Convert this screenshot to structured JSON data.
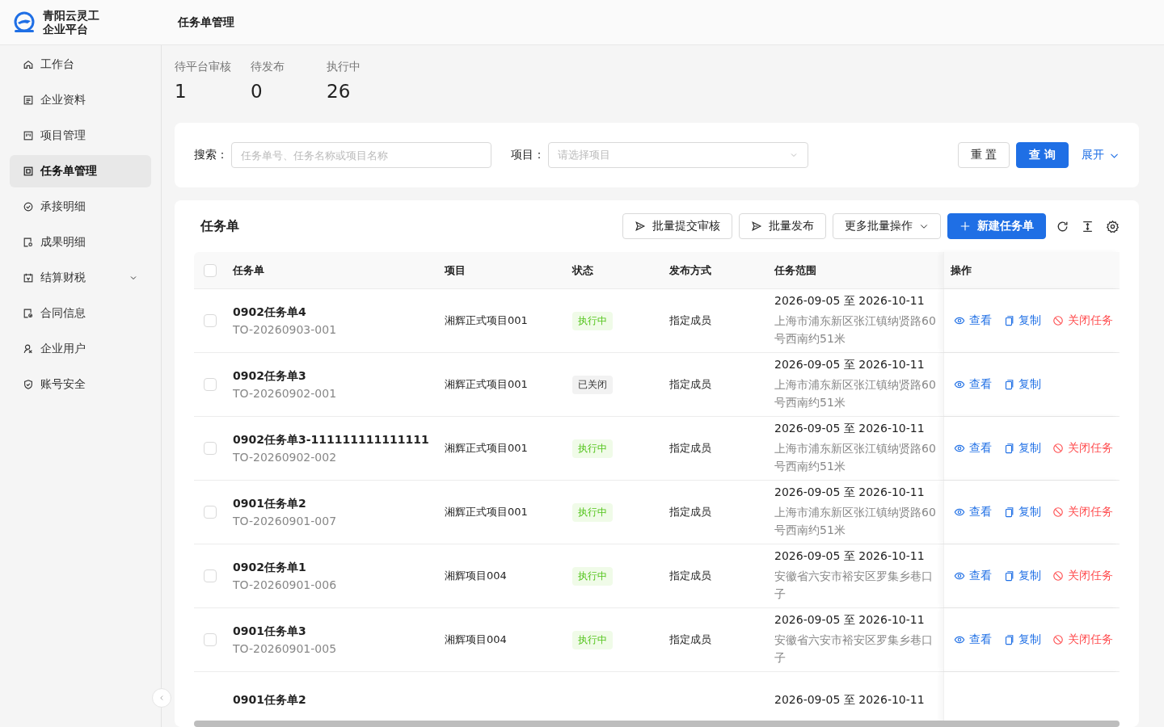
{
  "brand": {
    "line1": "青阳云灵工",
    "line2": "企业平台"
  },
  "header": {
    "title": "任务单管理"
  },
  "sidebar": {
    "items": [
      {
        "label": "工作台",
        "kind": "link",
        "selected": false
      },
      {
        "label": "企业资料",
        "kind": "link",
        "selected": false
      },
      {
        "label": "项目管理",
        "kind": "link",
        "selected": false
      },
      {
        "label": "任务单管理",
        "kind": "link",
        "selected": true
      },
      {
        "label": "承接明细",
        "kind": "link",
        "selected": false
      },
      {
        "label": "成果明细",
        "kind": "link",
        "selected": false
      },
      {
        "label": "结算财税",
        "kind": "group",
        "selected": false,
        "expanded": false
      },
      {
        "label": "合同信息",
        "kind": "link",
        "selected": false
      },
      {
        "label": "企业用户",
        "kind": "link",
        "selected": false
      },
      {
        "label": "账号安全",
        "kind": "link",
        "selected": false
      }
    ]
  },
  "stats": [
    {
      "label": "待平台审核",
      "value": "1"
    },
    {
      "label": "待发布",
      "value": "0"
    },
    {
      "label": "执行中",
      "value": "26"
    }
  ],
  "filters": {
    "search_label": "搜索：",
    "search_placeholder": "任务单号、任务名称或项目名称",
    "project_label": "项目：",
    "project_placeholder": "请选择项目",
    "reset": "重 置",
    "query": "查 询",
    "expand": "展开"
  },
  "table": {
    "title": "任务单",
    "toolbar": [
      {
        "label": "批量提交审核",
        "kind": "send"
      },
      {
        "label": "批量发布",
        "kind": "send"
      },
      {
        "label": "更多批量操作",
        "kind": "dropdown"
      },
      {
        "label": "新建任务单",
        "kind": "primary"
      }
    ],
    "columns": [
      "任务单",
      "项目",
      "状态",
      "发布方式",
      "任务范围",
      "操作"
    ],
    "select_all_checked": false,
    "rows": [
      {
        "checked": false,
        "name": "0902任务单4",
        "code": "TO-20260903-001",
        "project": "湘辉正式项目001",
        "status": {
          "label": "执行中",
          "kind": "running"
        },
        "method": "指定成员",
        "range": "2026-09-05 至 2026-10-11",
        "address": "上海市浦东新区张江镇纳贤路60号西南约51米",
        "actions": [
          {
            "label": "查看",
            "kind": "view"
          },
          {
            "label": "复制",
            "kind": "copy"
          },
          {
            "label": "关闭任务",
            "kind": "close"
          }
        ]
      },
      {
        "checked": false,
        "name": "0902任务单3",
        "code": "TO-20260902-001",
        "project": "湘辉正式项目001",
        "status": {
          "label": "已关闭",
          "kind": "closed"
        },
        "method": "指定成员",
        "range": "2026-09-05 至 2026-10-11",
        "address": "上海市浦东新区张江镇纳贤路60号西南约51米",
        "actions": [
          {
            "label": "查看",
            "kind": "view"
          },
          {
            "label": "复制",
            "kind": "copy"
          }
        ]
      },
      {
        "checked": false,
        "name": "0902任务单3-111111111111111",
        "code": "TO-20260902-002",
        "project": "湘辉正式项目001",
        "status": {
          "label": "执行中",
          "kind": "running"
        },
        "method": "指定成员",
        "range": "2026-09-05 至 2026-10-11",
        "address": "上海市浦东新区张江镇纳贤路60号西南约51米",
        "actions": [
          {
            "label": "查看",
            "kind": "view"
          },
          {
            "label": "复制",
            "kind": "copy"
          },
          {
            "label": "关闭任务",
            "kind": "close"
          }
        ]
      },
      {
        "checked": false,
        "name": "0901任务单2",
        "code": "TO-20260901-007",
        "project": "湘辉正式项目001",
        "status": {
          "label": "执行中",
          "kind": "running"
        },
        "method": "指定成员",
        "range": "2026-09-05 至 2026-10-11",
        "address": "上海市浦东新区张江镇纳贤路60号西南约51米",
        "actions": [
          {
            "label": "查看",
            "kind": "view"
          },
          {
            "label": "复制",
            "kind": "copy"
          },
          {
            "label": "关闭任务",
            "kind": "close"
          }
        ]
      },
      {
        "checked": false,
        "name": "0902任务单1",
        "code": "TO-20260901-006",
        "project": "湘辉项目004",
        "status": {
          "label": "执行中",
          "kind": "running"
        },
        "method": "指定成员",
        "range": "2026-09-05 至 2026-10-11",
        "address": "安徽省六安市裕安区罗集乡巷口子",
        "actions": [
          {
            "label": "查看",
            "kind": "view"
          },
          {
            "label": "复制",
            "kind": "copy"
          },
          {
            "label": "关闭任务",
            "kind": "close"
          }
        ]
      },
      {
        "checked": false,
        "name": "0901任务单3",
        "code": "TO-20260901-005",
        "project": "湘辉项目004",
        "status": {
          "label": "执行中",
          "kind": "running"
        },
        "method": "指定成员",
        "range": "2026-09-05 至 2026-10-11",
        "address": "安徽省六安市裕安区罗集乡巷口子",
        "actions": [
          {
            "label": "查看",
            "kind": "view"
          },
          {
            "label": "复制",
            "kind": "copy"
          },
          {
            "label": "关闭任务",
            "kind": "close"
          }
        ]
      },
      {
        "name": "0901任务单2",
        "range": "2026-09-05 至 2026-10-11"
      }
    ]
  }
}
